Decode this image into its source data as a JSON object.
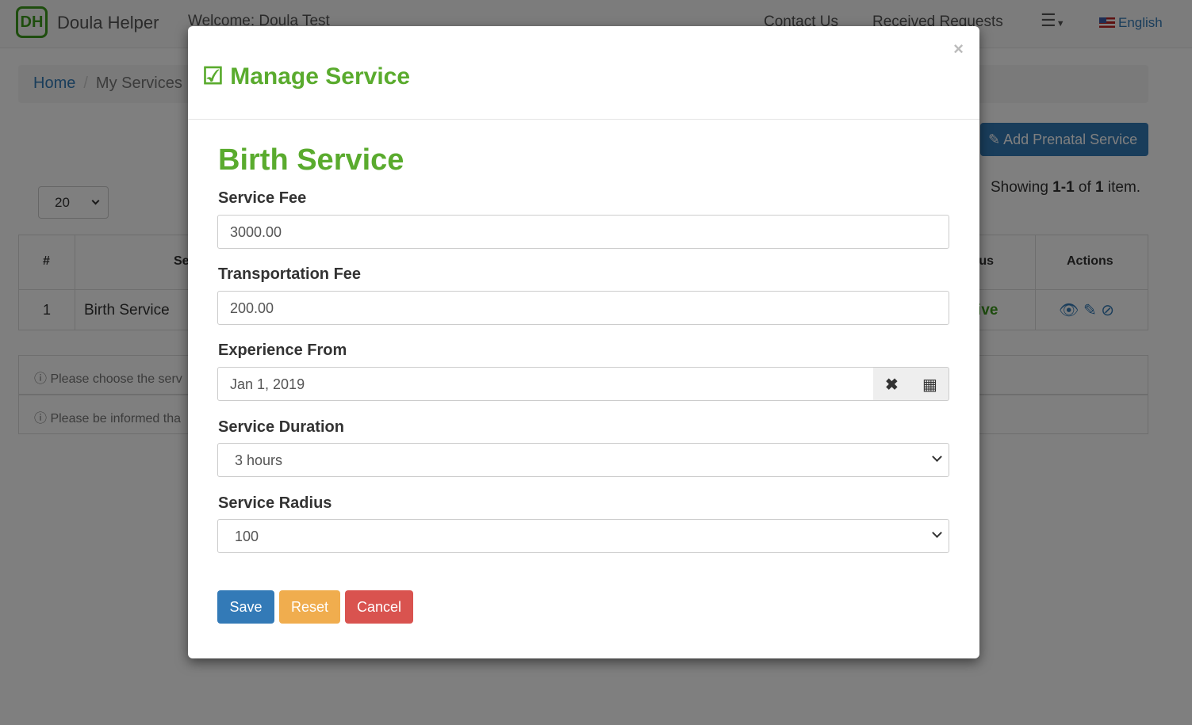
{
  "navbar": {
    "logo": "DH",
    "brand": "Doula Helper",
    "welcome": "Welcome: Doula Test",
    "contact": "Contact Us",
    "requests": "Received Requests",
    "menu_icon": "hamburger-icon",
    "language": "English"
  },
  "breadcrumb": {
    "home": "Home",
    "current": "My Services"
  },
  "page": {
    "add_button": "Add Prenatal Service",
    "showing_prefix": "Showing ",
    "showing_range": "1-1",
    "showing_of": " of ",
    "showing_total": "1",
    "showing_suffix": " item.",
    "page_size": "20"
  },
  "table": {
    "headers": [
      "#",
      "Se",
      "tus",
      "Actions"
    ],
    "row": {
      "num": "1",
      "service": "Birth Service",
      "status": "ive"
    },
    "status_color": "#3c9a1c"
  },
  "notices": [
    "Please choose the serv",
    "Please be informed tha"
  ],
  "modal": {
    "title": "Manage Service",
    "section": "Birth Service",
    "close": "×",
    "fields": {
      "service_fee_label": "Service Fee",
      "service_fee": "3000.00",
      "transport_label": "Transportation Fee",
      "transport": "200.00",
      "experience_label": "Experience From",
      "experience": "Jan 1, 2019",
      "duration_label": "Service Duration",
      "duration": "3 hours",
      "radius_label": "Service Radius",
      "radius": "100"
    },
    "buttons": {
      "save": "Save",
      "reset": "Reset",
      "cancel": "Cancel"
    }
  },
  "colors": {
    "accent": "#5aab2e",
    "primary": "#337ab7",
    "warning": "#f0ad4e",
    "danger": "#d9534f"
  }
}
